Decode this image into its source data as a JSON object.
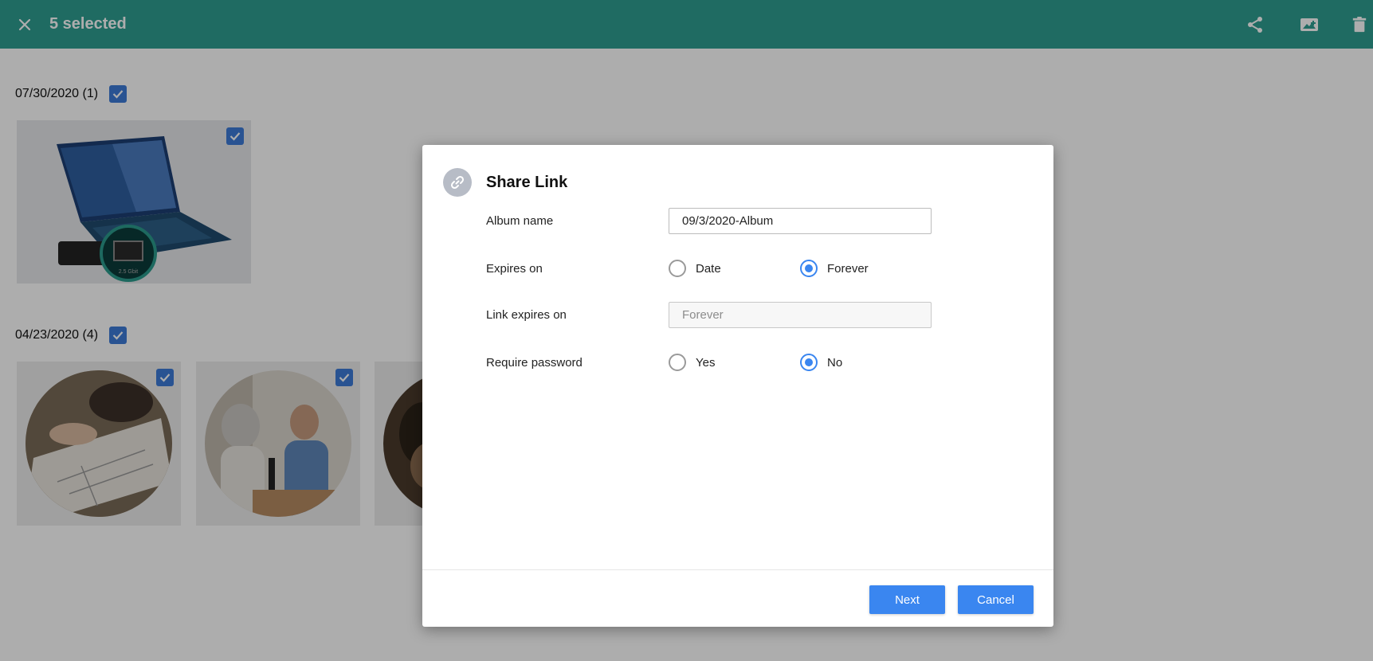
{
  "topbar": {
    "selected_label": "5 selected",
    "close_icon": "close-icon",
    "actions": [
      "share-icon",
      "add-to-album-icon",
      "delete-icon"
    ],
    "color": "#2f9e91"
  },
  "gallery": {
    "groups": [
      {
        "date_label": "07/30/2020 (1)",
        "checked": true,
        "photo_count": 1
      },
      {
        "date_label": "04/23/2020 (4)",
        "checked": true,
        "photo_count": 4
      }
    ]
  },
  "dialog": {
    "title": "Share Link",
    "icon": "link-icon",
    "fields": {
      "album_name": {
        "label": "Album name",
        "value": "09/3/2020-Album"
      },
      "expires_on": {
        "label": "Expires on",
        "options": [
          "Date",
          "Forever"
        ],
        "selected": "Forever"
      },
      "link_expires_on": {
        "label": "Link expires on",
        "value": "Forever"
      },
      "require_password": {
        "label": "Require password",
        "options": [
          "Yes",
          "No"
        ],
        "selected": "No"
      }
    },
    "buttons": {
      "next": "Next",
      "cancel": "Cancel"
    },
    "accent_color": "#3a86f0"
  }
}
